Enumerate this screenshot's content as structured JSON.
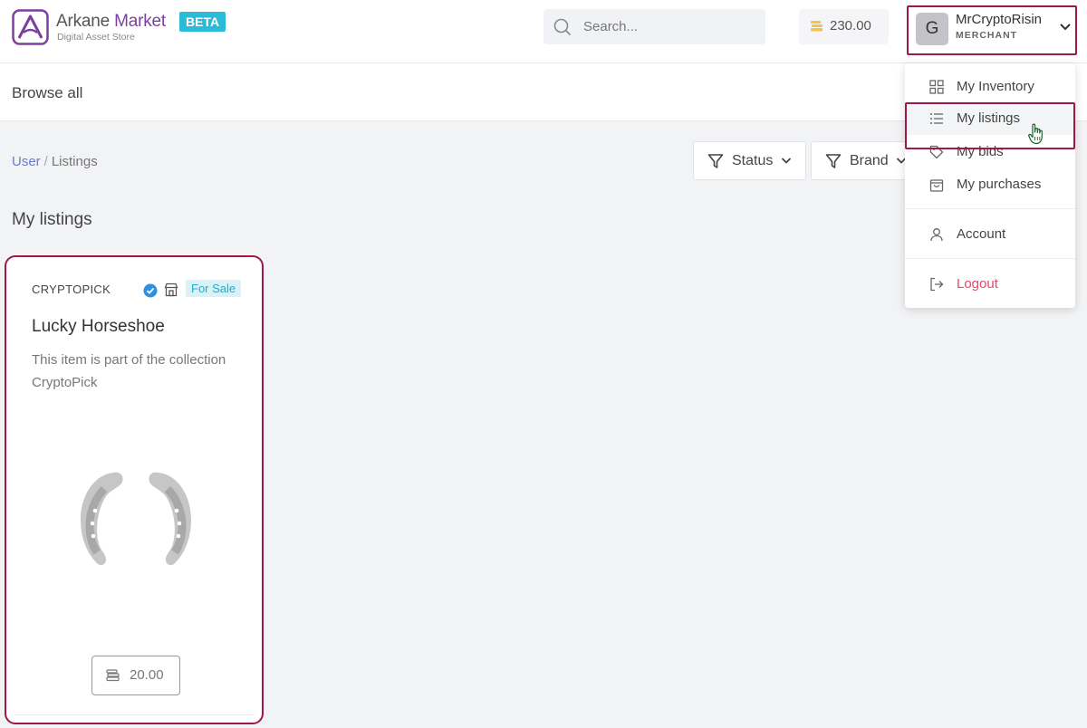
{
  "header": {
    "brand_first": "Arkane",
    "brand_second": " Market",
    "brand_subtitle": "Digital Asset Store",
    "beta_label": "BETA",
    "search_placeholder": "Search...",
    "balance": "230.00",
    "user": {
      "avatar_letter": "G",
      "name": "MrCryptoRisin",
      "role": "MERCHANT"
    }
  },
  "subnav": {
    "browse_label": "Browse all"
  },
  "breadcrumb": {
    "parent": "User",
    "current": "Listings"
  },
  "filters": [
    {
      "label": "Status"
    },
    {
      "label": "Brand"
    }
  ],
  "section_title": "My listings",
  "listing": {
    "brand": "CRYPTOPICK",
    "status": "For Sale",
    "title": "Lucky Horseshoe",
    "description": "This item is part of the collection CryptoPick",
    "price": "20.00"
  },
  "user_menu": {
    "items": [
      {
        "label": "My Inventory",
        "icon": "grid-icon"
      },
      {
        "label": "My listings",
        "icon": "list-icon"
      },
      {
        "label": "My bids",
        "icon": "tag-icon"
      },
      {
        "label": "My purchases",
        "icon": "bag-icon"
      },
      {
        "label": "Account",
        "icon": "user-icon"
      },
      {
        "label": "Logout",
        "icon": "logout-icon"
      }
    ]
  },
  "colors": {
    "accent_purple": "#7b3fa0",
    "beta_bg": "#2bbbd8",
    "highlight_border": "#a01847",
    "logout_red": "#e8486a",
    "link_blue": "#6d7bc9"
  }
}
